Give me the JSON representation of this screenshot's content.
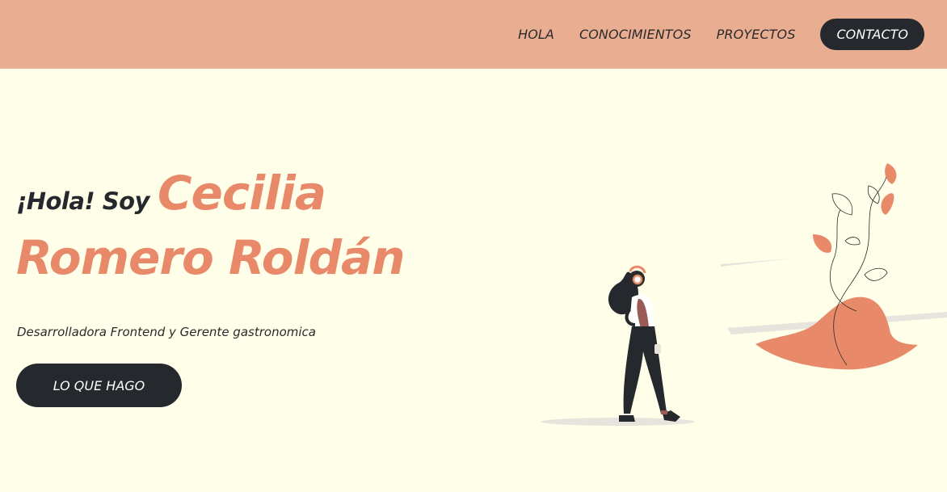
{
  "nav": {
    "links": [
      "HOLA",
      "CONOCIMIENTOS",
      "PROYECTOS"
    ],
    "cta": "CONTACTO"
  },
  "hero": {
    "greeting": "¡Hola! Soy",
    "name_line1": "Cecilia",
    "name_line2": "Romero Roldán",
    "subtitle": "Desarrolladora Frontend y Gerente gastronomica",
    "button": "LO QUE HAGO"
  },
  "colors": {
    "header_bg": "#e9ad92",
    "page_bg": "#fffee9",
    "accent": "#e8896a",
    "dark": "#25282c"
  },
  "illustration": {
    "icon": "woman-with-headphones-and-plant-illustration"
  }
}
